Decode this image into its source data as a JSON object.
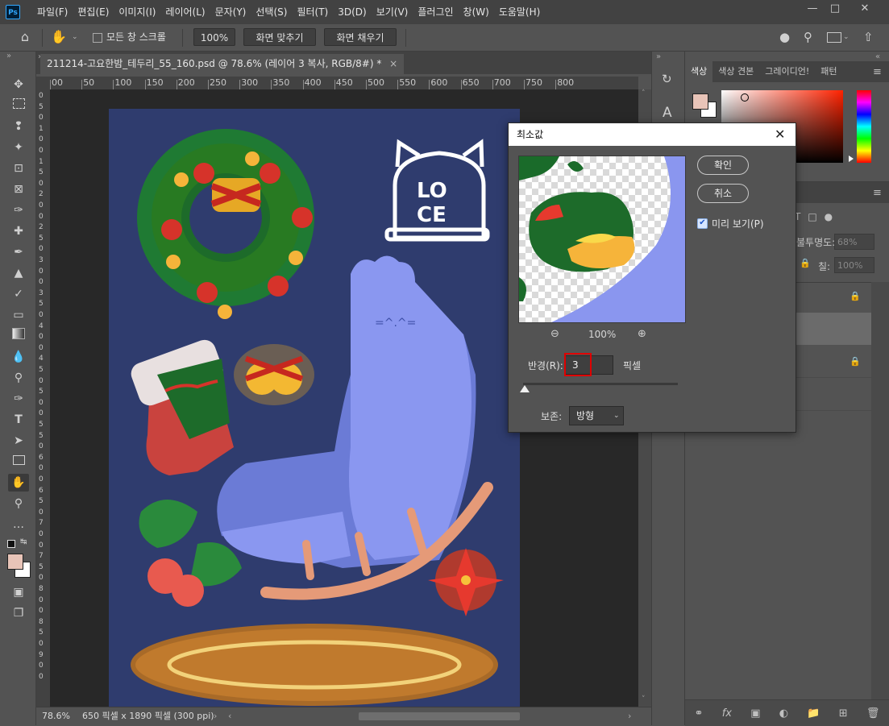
{
  "app": {
    "logo": "Ps",
    "menu": [
      "파일(F)",
      "편집(E)",
      "이미지(I)",
      "레이어(L)",
      "문자(Y)",
      "선택(S)",
      "필터(T)",
      "3D(D)",
      "보기(V)",
      "플러그인",
      "창(W)",
      "도움말(H)"
    ]
  },
  "options_bar": {
    "scroll_all_label": "모든 창 스크롤",
    "zoom_value": "100%",
    "fit_screen_label": "화면 맞추기",
    "fill_screen_label": "화면 채우기"
  },
  "document": {
    "tab_title": "211214-고요한밤_테두리_55_160.psd @ 78.6% (레이어 3 복사, RGB/8#) *",
    "ruler_labels": [
      "00",
      "50",
      "100",
      "150",
      "200",
      "250",
      "300",
      "350",
      "400",
      "450",
      "500",
      "550",
      "600",
      "650",
      "700",
      "750",
      "800"
    ],
    "v_ruler_labels": [
      "0",
      "5",
      "0",
      "1",
      "0",
      "0",
      "1",
      "5",
      "0",
      "2",
      "0",
      "0",
      "2",
      "5",
      "0",
      "3",
      "0",
      "0",
      "3",
      "5",
      "0",
      "4",
      "0",
      "0",
      "4",
      "5",
      "0",
      "5",
      "0",
      "0",
      "5",
      "5",
      "0",
      "6",
      "0",
      "0",
      "6",
      "5",
      "0",
      "7",
      "0",
      "0",
      "7",
      "5",
      "0",
      "8",
      "0",
      "0",
      "8",
      "5",
      "0",
      "9",
      "0",
      "0"
    ]
  },
  "status_bar": {
    "zoom": "78.6%",
    "dimensions": "650 픽셀 x 1890 픽셀 (300 ppi)"
  },
  "color_panel": {
    "tabs": [
      "색상",
      "색상 견본",
      "그레이디언!",
      "패턴"
    ],
    "foreground_color": "#e8c4b8",
    "background_color": "#ffffff"
  },
  "layers_panel": {
    "opacity_label": "불투명도:",
    "opacity_value": "68%",
    "fill_label": "칠:",
    "fill_value": "100%"
  },
  "dialog": {
    "title": "최소값",
    "ok_label": "확인",
    "cancel_label": "취소",
    "preview_label": "미리 보기(P)",
    "preview_checked": true,
    "preview_zoom": "100%",
    "radius_label": "반경(R):",
    "radius_value": "3",
    "radius_unit": "픽셀",
    "preserve_label": "보존:",
    "preserve_value": "방형"
  }
}
